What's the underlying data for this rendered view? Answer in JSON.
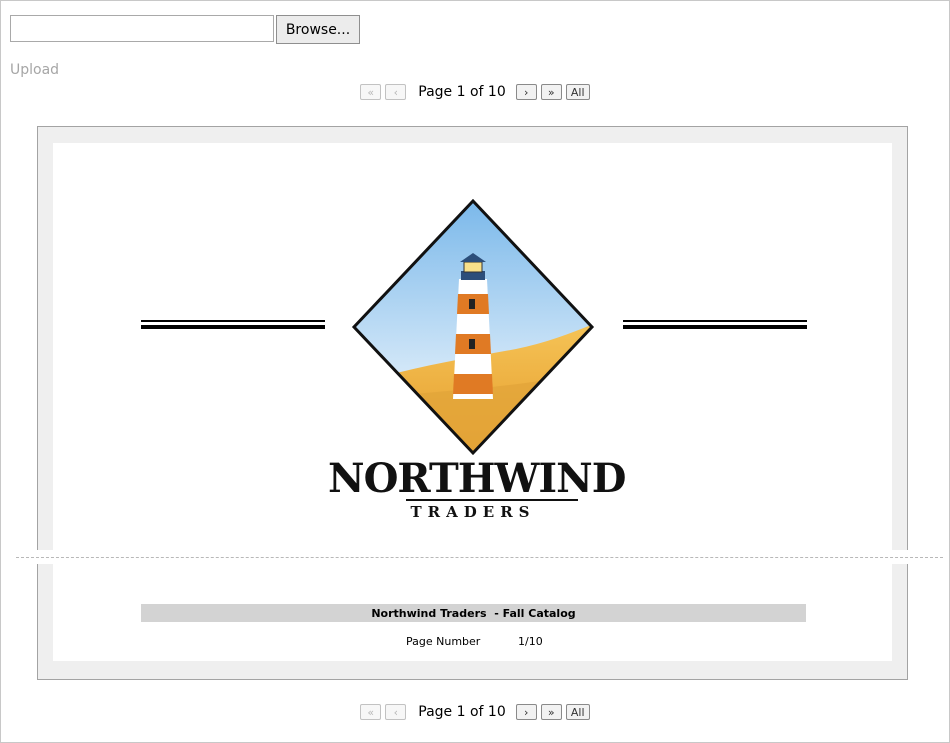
{
  "upload": {
    "file_value": "",
    "browse_label": "Browse...",
    "upload_label": "Upload"
  },
  "pager": {
    "first_icon": "double-chevron-left-icon",
    "prev_icon": "chevron-left-icon",
    "next_icon": "chevron-right-icon",
    "last_icon": "double-chevron-right-icon",
    "first_symbol": "«",
    "prev_symbol": "‹",
    "next_symbol": "›",
    "last_symbol": "»",
    "page_text": "Page 1 of 10",
    "all_label": "All"
  },
  "report": {
    "logo_icon": "lighthouse-logo-icon",
    "brand_name": "NORTHWIND",
    "brand_subtitle": "TRADERS",
    "footer_title": "Northwind Traders  - Fall Catalog",
    "page_number_label": "Page Number",
    "page_number_value": "1/10"
  },
  "colors": {
    "sky_top": "#8fc4ee",
    "sand": "#f0b43c",
    "stripe_orange": "#e07a24",
    "footer_bar": "#d3d3d3"
  }
}
